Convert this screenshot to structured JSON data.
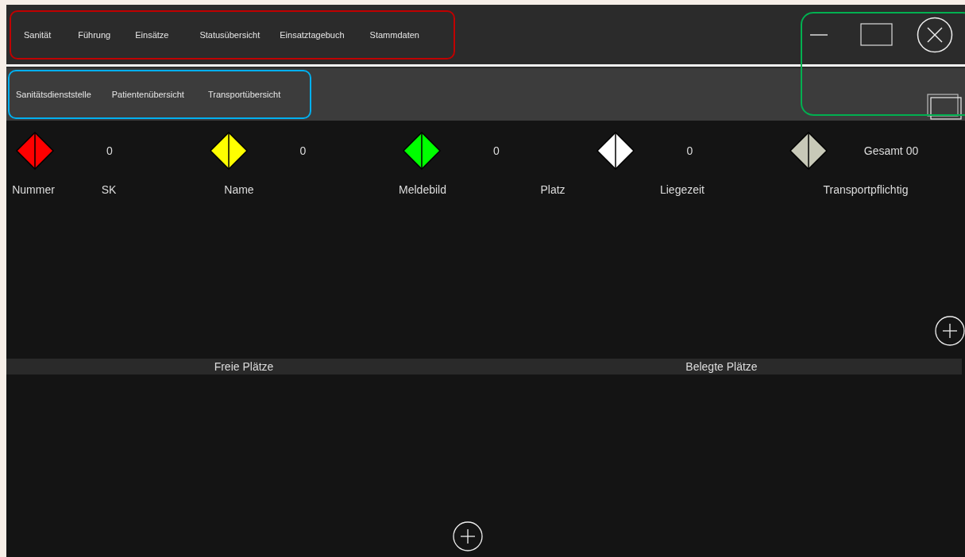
{
  "main_nav": [
    {
      "label": "Sanität"
    },
    {
      "label": "Führung"
    },
    {
      "label": "Einsätze"
    },
    {
      "label": "Statusübersicht"
    },
    {
      "label": "Einsatztagebuch"
    },
    {
      "label": "Stammdaten"
    }
  ],
  "sub_nav": [
    {
      "label": "Sanitätsdienststelle"
    },
    {
      "label": "Patientenübersicht"
    },
    {
      "label": "Transportübersicht"
    }
  ],
  "triage": [
    {
      "color": "#ff0000",
      "count": "0"
    },
    {
      "color": "#ffff00",
      "count": "0"
    },
    {
      "color": "#00ff00",
      "count": "0"
    },
    {
      "color": "#ffffff",
      "count": "0"
    },
    {
      "color": "#c8c9b8",
      "count": "Gesamt 00"
    }
  ],
  "patient_table": {
    "columns": [
      "Nummer",
      "SK",
      "Name",
      "Meldebild",
      "Platz",
      "Liegezeit",
      "Transportpflichtig"
    ]
  },
  "places": {
    "columns": [
      "Freie Plätze",
      "Belegte Plätze"
    ]
  }
}
